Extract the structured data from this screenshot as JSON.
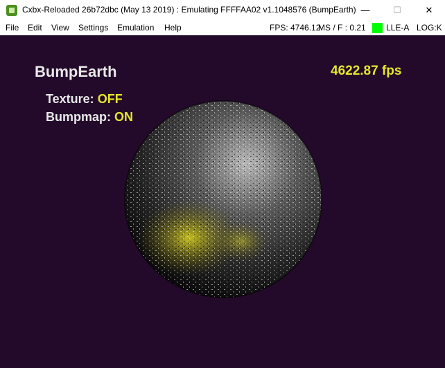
{
  "window": {
    "title": "Cxbx-Reloaded 26b72dbc (May 13 2019) : Emulating FFFFAA02 v1.1048576 (BumpEarth)",
    "minimize_glyph": "—",
    "maximize_glyph": "☐",
    "close_glyph": "✕"
  },
  "menu": {
    "items": [
      "File",
      "Edit",
      "View",
      "Settings",
      "Emulation",
      "Help"
    ]
  },
  "status": {
    "fps": "FPS: 4746.12",
    "ms_per_frame": "MS / F : 0.21",
    "lle": "LLE-A",
    "log": "LOG:K",
    "led_color": "#00ff00"
  },
  "scene": {
    "title": "BumpEarth",
    "fps": "4622.87 fps",
    "texture_label": "Texture:",
    "texture_value": "OFF",
    "bumpmap_label": "Bumpmap:",
    "bumpmap_value": "ON",
    "background_color": "#230a2a",
    "highlight_color": "#e6e62a"
  }
}
